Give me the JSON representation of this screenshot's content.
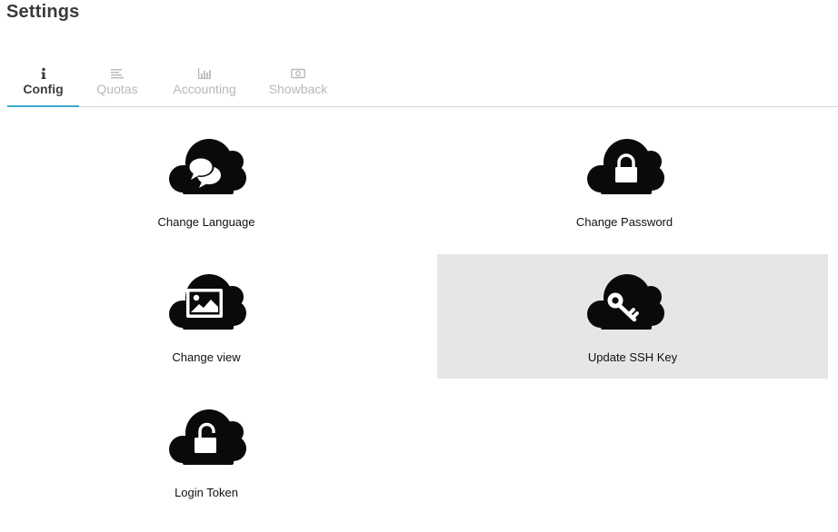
{
  "page": {
    "title": "Settings"
  },
  "tabs": [
    {
      "label": "Config",
      "icon": "info-icon",
      "active": true
    },
    {
      "label": "Quotas",
      "icon": "align-left-icon",
      "active": false
    },
    {
      "label": "Accounting",
      "icon": "bar-chart-icon",
      "active": false
    },
    {
      "label": "Showback",
      "icon": "money-icon",
      "active": false
    }
  ],
  "tiles": [
    {
      "label": "Change Language",
      "icon": "chat-bubbles-icon"
    },
    {
      "label": "Change Password",
      "icon": "lock-icon"
    },
    {
      "label": "Change view",
      "icon": "picture-icon"
    },
    {
      "label": "Update SSH Key",
      "icon": "key-icon",
      "selected": true
    },
    {
      "label": "Login Token",
      "icon": "unlock-icon"
    }
  ],
  "colors": {
    "accent": "#3aa9d0",
    "selected_tile_bg": "#e6e6e6",
    "cloud": "#0a0a0a"
  }
}
